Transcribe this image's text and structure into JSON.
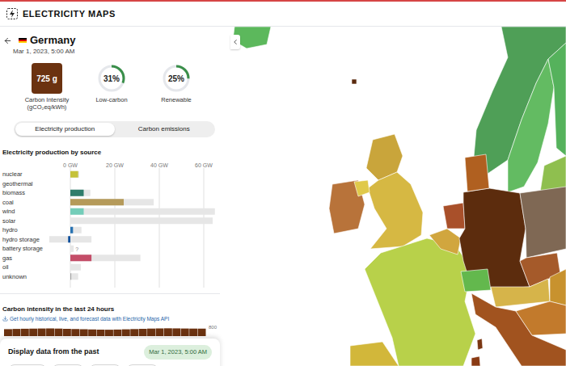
{
  "header": {
    "title": "ELECTRICITY MAPS"
  },
  "zone": {
    "name": "Germany",
    "datetime": "Mar 1, 2023, 5:00 AM"
  },
  "metrics": {
    "carbon_intensity": {
      "value": "725 g",
      "label": "Carbon Intensity",
      "unit": "(gCO₂eq/kWh)",
      "color": "#6b3210"
    },
    "low_carbon": {
      "value": "31%",
      "label": "Low-carbon",
      "level": 0.31
    },
    "renewable": {
      "value": "25%",
      "label": "Renewable",
      "level": 0.25
    }
  },
  "view_toggle": [
    {
      "label": "Electricity production",
      "selected": true
    },
    {
      "label": "Carbon emissions",
      "selected": false
    }
  ],
  "production_chart": {
    "title": "Electricity production by source",
    "ticks": [
      {
        "label": "0 GW",
        "value": 0
      },
      {
        "label": "20 GW",
        "value": 20
      },
      {
        "label": "40 GW",
        "value": 40
      },
      {
        "label": "60 GW",
        "value": 60
      }
    ],
    "sources": [
      {
        "label": "nuclear",
        "production": 3.5,
        "capacity_range": [
          0,
          4
        ],
        "color": "#c5c23a",
        "note": ""
      },
      {
        "label": "geothermal",
        "production": 0,
        "capacity_range": [
          0,
          0
        ],
        "color": "#9c5a3c",
        "note": ""
      },
      {
        "label": "biomass",
        "production": 6,
        "capacity_range": [
          0,
          9
        ],
        "color": "#2f7d6b",
        "note": ""
      },
      {
        "label": "coal",
        "production": 24,
        "capacity_range": [
          0,
          37.5
        ],
        "color": "#b59a5a",
        "note": ""
      },
      {
        "label": "wind",
        "production": 6,
        "capacity_range": [
          0,
          65
        ],
        "color": "#74cdb9",
        "note": ""
      },
      {
        "label": "solar",
        "production": 0,
        "capacity_range": [
          0,
          64
        ],
        "color": "#f5c842",
        "note": ""
      },
      {
        "label": "hydro",
        "production": 1.2,
        "capacity_range": [
          0,
          5
        ],
        "color": "#2772b2",
        "note": ""
      },
      {
        "label": "hydro storage",
        "production": -1,
        "capacity_range": [
          -9.5,
          9.5
        ],
        "color": "#0b4f9c",
        "note": ""
      },
      {
        "label": "battery storage",
        "production": 0,
        "capacity_range": [
          0,
          1.5
        ],
        "color": "#6b6bb8",
        "note": "?"
      },
      {
        "label": "gas",
        "production": 9.5,
        "capacity_range": [
          0,
          31.5
        ],
        "color": "#c44d68",
        "note": ""
      },
      {
        "label": "oil",
        "production": 0,
        "capacity_range": [
          0,
          4.7
        ],
        "color": "#867d66",
        "note": ""
      },
      {
        "label": "unknown",
        "production": 0.4,
        "capacity_range": [
          0,
          3.5
        ],
        "color": "#a3a3a3",
        "note": ""
      }
    ]
  },
  "history": {
    "title": "Carbon intensity in the last 24 hours",
    "link": "Get hourly historical, live, and forecast data with Electricity Maps API",
    "axis_max": "800",
    "color": "#6b3210",
    "values": [
      712,
      718,
      722,
      725,
      728,
      730,
      726,
      720,
      715,
      710,
      705,
      700,
      698,
      702,
      708,
      714,
      720,
      726,
      730,
      733,
      731,
      728,
      726,
      725
    ]
  },
  "time_panel": {
    "title": "Display data from the past",
    "selected_time": "Mar 1, 2023, 5:00 AM",
    "buttons": [
      {
        "selected": false
      },
      {
        "selected": false
      },
      {
        "selected": false
      },
      {
        "selected": false
      }
    ]
  },
  "map": {
    "regions": [
      {
        "color": "#5cb85c"
      },
      {
        "color": "#4f9f57"
      },
      {
        "color": "#63bb62"
      },
      {
        "color": "#55b25c"
      },
      {
        "color": "#8fbf4f"
      },
      {
        "color": "#5a2a0e"
      },
      {
        "color": "#c9a53b"
      },
      {
        "color": "#d6b843"
      },
      {
        "color": "#b8733a"
      },
      {
        "color": "#e0c94a"
      },
      {
        "color": "#b8d14a"
      },
      {
        "color": "#d1a63e"
      },
      {
        "color": "#a9502a"
      },
      {
        "color": "#5c2c0d"
      },
      {
        "color": "#b06020"
      },
      {
        "color": "#7f6854"
      },
      {
        "color": "#a55a2a"
      },
      {
        "color": "#63b84d"
      },
      {
        "color": "#d6b44a"
      },
      {
        "color": "#c8922e"
      },
      {
        "color": "#a1531f"
      },
      {
        "color": "#c27a2c"
      },
      {
        "color": "#d2b73a"
      },
      {
        "color": "#7a3612"
      },
      {
        "color": "#8a3b14"
      }
    ]
  }
}
